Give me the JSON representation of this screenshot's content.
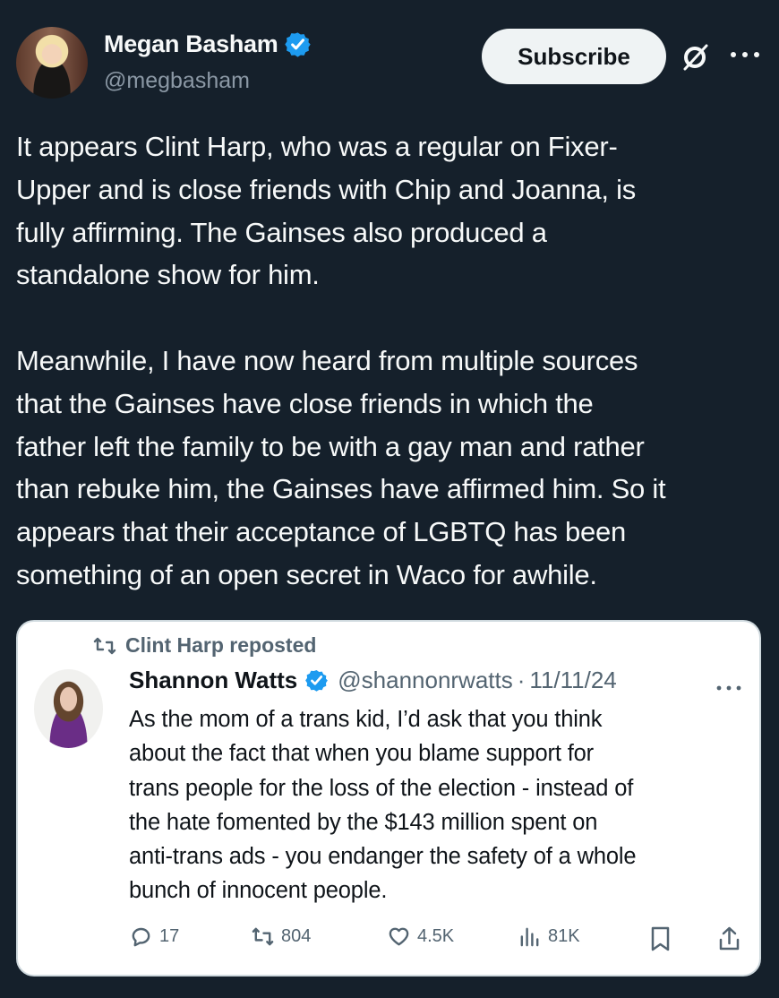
{
  "colors": {
    "background": "#15202b",
    "verified": "#1d9bf0",
    "subscribe_bg": "#eff3f4",
    "quote_bg": "#ffffff",
    "muted": "#536471"
  },
  "post": {
    "author": {
      "name": "Megan Basham",
      "handle": "@megbasham",
      "verified": true,
      "avatar_icon": "avatar-photo"
    },
    "subscribe_label": "Subscribe",
    "icons": [
      "verified-badge-icon",
      "grok-icon",
      "more-options-icon"
    ],
    "text": "It appears Clint Harp, who was a regular on Fixer-\nUpper and is close friends with Chip and Joanna, is\nfully affirming. The Gainses also produced a\nstandalone show for him.\n\nMeanwhile, I have now heard from multiple sources\nthat the Gainses have close friends in which the\nfather left the family to be with a gay man and rather\nthan rebuke him, the Gainses have affirmed him. So it\nappears that their acceptance of LGBTQ has been\nsomething of an open secret in Waco for awhile."
  },
  "quoted_post": {
    "reposted_label": "Clint Harp reposted",
    "author": {
      "name": "Shannon Watts",
      "handle": "@shannonrwatts",
      "date": "11/11/24",
      "verified": true,
      "avatar_icon": "avatar-photo"
    },
    "text": "As the mom of a trans kid, I’d ask that you think\nabout the fact that when you blame support for\ntrans people for the loss of the election - instead of\nthe hate fomented by the $143 million spent on\nanti-trans ads - you endanger the safety of a whole\nbunch of innocent people.",
    "metrics": {
      "replies": "17",
      "reposts": "804",
      "likes": "4.5K",
      "views": "81K"
    },
    "icons": [
      "repost-icon",
      "reply-icon",
      "like-icon",
      "views-icon",
      "bookmark-icon",
      "share-icon"
    ]
  }
}
